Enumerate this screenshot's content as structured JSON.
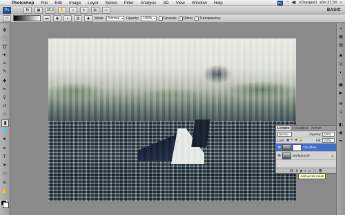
{
  "menubar": {
    "app_name": "Photoshop",
    "items": [
      "File",
      "Edit",
      "Image",
      "Layer",
      "Select",
      "Filter",
      "Analysis",
      "3D",
      "View",
      "Window",
      "Help"
    ],
    "status": "(Charged)",
    "clock": "sön 21.55"
  },
  "appbar": {
    "logo": "Ps",
    "zoom": "33.3",
    "workspace": "BASIC"
  },
  "options": {
    "mode_label": "Mode:",
    "mode_value": "Normal",
    "opacity_label": "Opacity:",
    "opacity_value": "100%",
    "reverse_label": "Reverse",
    "dither_label": "Dither",
    "transparency_label": "Transparency"
  },
  "layers_panel": {
    "tabs": [
      "LAYERS",
      "CHANNELS",
      "PATHS"
    ],
    "blend_mode": "Normal",
    "opacity_label": "Opacity:",
    "opacity_value": "100%",
    "lock_label": "Lock:",
    "fill_label": "Fill:",
    "fill_value": "100%",
    "layers": [
      {
        "name": "T/S effect",
        "selected": true
      },
      {
        "name": "Background",
        "selected": false
      }
    ],
    "footer_icons": [
      "link-icon",
      "fx-icon",
      "mask-icon",
      "adjustment-icon",
      "folder-icon",
      "new-layer-icon",
      "trash-icon"
    ]
  },
  "tooltip": "Add vector mask"
}
